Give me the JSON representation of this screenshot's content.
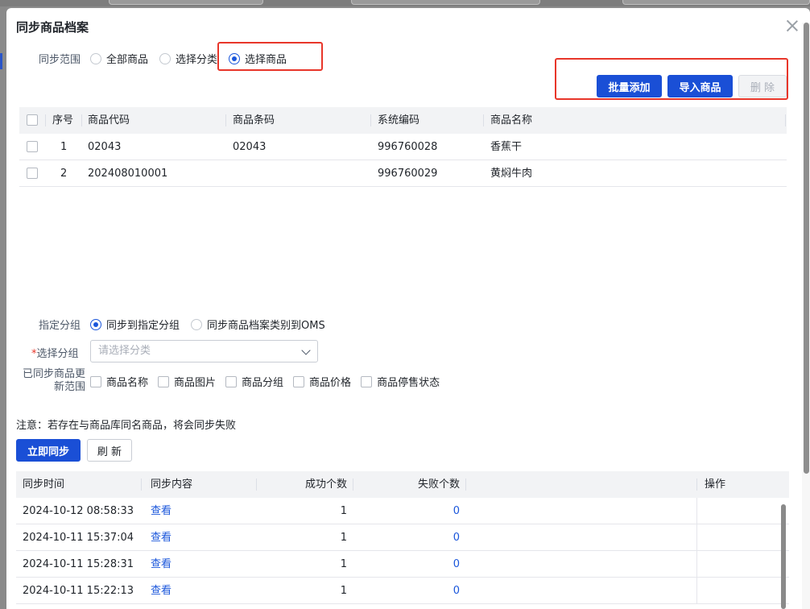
{
  "modal": {
    "title": "同步商品档案"
  },
  "sync_scope": {
    "label": "同步范围",
    "options": [
      "全部商品",
      "选择分类",
      "选择商品"
    ],
    "selected": "选择商品"
  },
  "toolbar": {
    "batch_add": "批量添加",
    "import_goods": "导入商品",
    "delete": "删 除"
  },
  "goods_table": {
    "headers": [
      "序号",
      "商品代码",
      "商品条码",
      "系统编码",
      "商品名称"
    ],
    "rows": [
      {
        "index": "1",
        "code": "02043",
        "barcode": "02043",
        "sys_code": "996760028",
        "name": "香蕉干"
      },
      {
        "index": "2",
        "code": "202408010001",
        "barcode": "",
        "sys_code": "996760029",
        "name": "黄焖牛肉"
      }
    ]
  },
  "group_target": {
    "label": "指定分组",
    "options": [
      "同步到指定分组",
      "同步商品档案类别到OMS"
    ],
    "selected": "同步到指定分组"
  },
  "group_select": {
    "required_mark": "*",
    "label": "选择分组",
    "placeholder": "请选择分类"
  },
  "update_scope": {
    "label_line1": "已同步商品更",
    "label_line2": "新范围",
    "options": [
      "商品名称",
      "商品图片",
      "商品分组",
      "商品价格",
      "商品停售状态"
    ]
  },
  "notice": "注意：若存在与商品库同名商品，将会同步失败",
  "actions": {
    "sync_now": "立即同步",
    "refresh": "刷 新"
  },
  "log_table": {
    "headers": [
      "同步时间",
      "同步内容",
      "成功个数",
      "失败个数",
      "操作"
    ],
    "rows": [
      {
        "time": "2024-10-12 08:58:33",
        "content": "查看",
        "success": "1",
        "fail": "0"
      },
      {
        "time": "2024-10-11 15:37:04",
        "content": "查看",
        "success": "1",
        "fail": "0"
      },
      {
        "time": "2024-10-11 15:28:31",
        "content": "查看",
        "success": "1",
        "fail": "0"
      },
      {
        "time": "2024-10-11 15:22:13",
        "content": "查看",
        "success": "1",
        "fail": "0"
      }
    ]
  },
  "colors": {
    "primary": "#1a4fd6",
    "highlight": "#e8362a",
    "link": "#1a56db"
  }
}
